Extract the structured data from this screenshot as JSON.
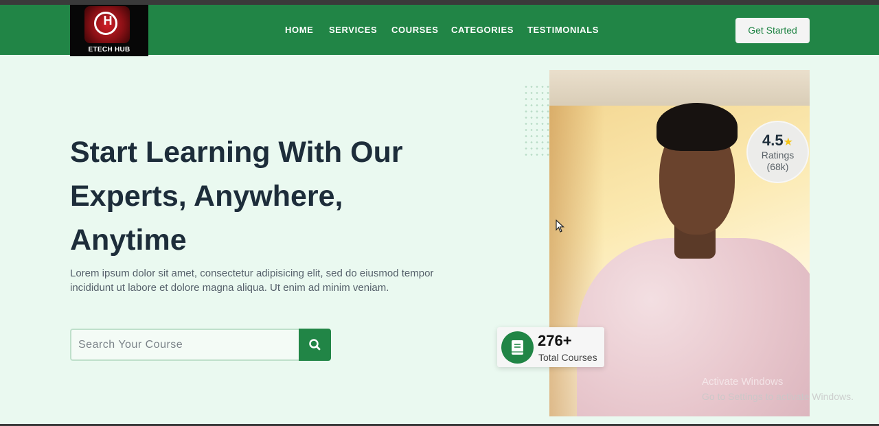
{
  "brand": {
    "name": "ETECH HUB",
    "monogram": "H"
  },
  "nav": {
    "items": [
      {
        "label": "HOME"
      },
      {
        "label": "SERVICES"
      },
      {
        "label": "COURSES"
      },
      {
        "label": "CATEGORIES"
      },
      {
        "label": "TESTIMONIALS"
      }
    ],
    "cta_label": "Get Started"
  },
  "hero": {
    "headline_lines": [
      "Start Learning With Our",
      "Experts, Anywhere,",
      "Anytime"
    ],
    "description": "Lorem ipsum dolor sit amet, consectetur adipisicing elit, sed do eiusmod tempor incididunt ut labore et dolore magna aliqua. Ut enim ad minim veniam.",
    "search": {
      "placeholder": "Search Your Course",
      "value": "",
      "button_icon": "search-icon"
    }
  },
  "rating_badge": {
    "value": "4.5",
    "star_icon": "star-icon",
    "label": "Ratings",
    "count": "(68k)"
  },
  "courses_badge": {
    "icon": "book-icon",
    "count": "276+",
    "label": "Total Courses"
  },
  "os_watermark": {
    "line1": "Activate Windows",
    "line2": "Go to Settings to activate Windows."
  },
  "colors": {
    "primary_green": "#218546",
    "page_background": "#eaf9f0",
    "heading_text": "#1d2d3a",
    "rating_star": "#f5c518"
  }
}
